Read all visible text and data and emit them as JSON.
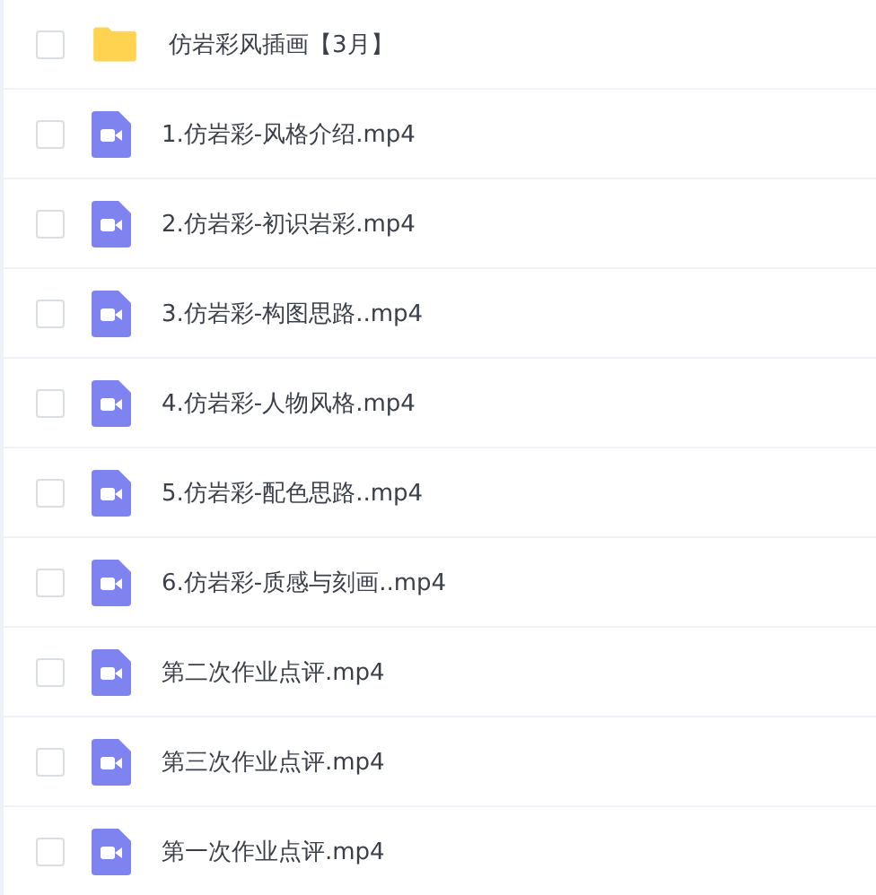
{
  "files": [
    {
      "kind": "folder",
      "name": "仿岩彩风插画【3月】",
      "checked": false
    },
    {
      "kind": "video",
      "name": "1.仿岩彩-风格介绍.mp4",
      "checked": false
    },
    {
      "kind": "video",
      "name": "2.仿岩彩-初识岩彩.mp4",
      "checked": false
    },
    {
      "kind": "video",
      "name": "3.仿岩彩-构图思路..mp4",
      "checked": false
    },
    {
      "kind": "video",
      "name": "4.仿岩彩-人物风格.mp4",
      "checked": false
    },
    {
      "kind": "video",
      "name": "5.仿岩彩-配色思路..mp4",
      "checked": false
    },
    {
      "kind": "video",
      "name": "6.仿岩彩-质感与刻画..mp4",
      "checked": false
    },
    {
      "kind": "video",
      "name": "第二次作业点评.mp4",
      "checked": false
    },
    {
      "kind": "video",
      "name": "第三次作业点评.mp4",
      "checked": false
    },
    {
      "kind": "video",
      "name": "第一次作业点评.mp4",
      "checked": false
    }
  ]
}
